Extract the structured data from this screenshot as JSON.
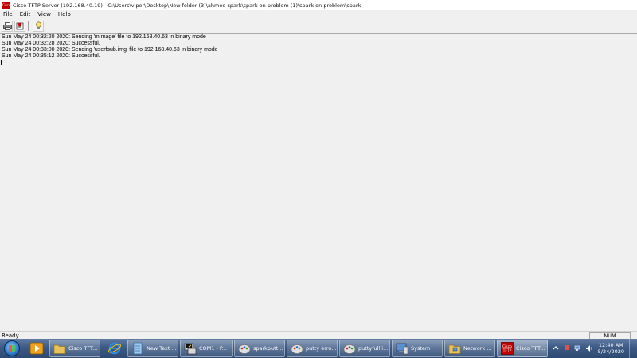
{
  "window": {
    "title": "Cisco TFTP Server (192.168.40.19) - C:\\Users\\viper\\Desktop\\New folder (3)\\ahmed spark\\spark on problem (1)\\spark on problem\\spark",
    "icon_text": "Cisco"
  },
  "menu": [
    "File",
    "Edit",
    "View",
    "Help"
  ],
  "toolbar": {
    "icons": [
      "printer-icon",
      "log-icon",
      "help-icon"
    ]
  },
  "log": [
    "Sun May 24 00:32:20 2020: Sending 'mImage' file to 192.168.40.63 in binary mode",
    "Sun May 24 00:32:28 2020: Successful.",
    "Sun May 24 00:33:00 2020: Sending 'userfsub.img' file to 192.168.40.63 in binary mode",
    "Sun May 24 00:35:12 2020: Successful."
  ],
  "status": {
    "text": "Ready",
    "indicator": "NUM"
  },
  "taskbar": {
    "pinned": [
      {
        "name": "media-player-icon",
        "color": "#f0a020"
      },
      {
        "name": "internet-explorer-icon",
        "color": "#2a8ce0"
      }
    ],
    "buttons": [
      {
        "label": "Cisco TFT...",
        "icon": "folder-icon",
        "color": "#e8c25a",
        "active": false
      },
      {
        "label": "New Text ...",
        "icon": "notepad-icon",
        "color": "#9cc8f0",
        "active": false
      },
      {
        "label": "COM1 - P...",
        "icon": "putty-icon",
        "color": "#d8d8d8",
        "active": false
      },
      {
        "label": "sparkputt...",
        "icon": "paint-icon",
        "color": "#e0e0e0",
        "active": false
      },
      {
        "label": "putty erro...",
        "icon": "paint-icon",
        "color": "#e0e0e0",
        "active": false
      },
      {
        "label": "puttyfull i...",
        "icon": "paint-icon",
        "color": "#e0e0e0",
        "active": false
      },
      {
        "label": "System",
        "icon": "system-icon",
        "color": "#5a8fd0",
        "active": false
      },
      {
        "label": "Network ...",
        "icon": "network-icon",
        "color": "#e8c25a",
        "active": false
      },
      {
        "label": "Cisco TFT...",
        "icon": "cisco-tftp-icon",
        "color": "#c00000",
        "active": true
      }
    ],
    "clock": {
      "time": "12:40 AM",
      "date": "5/24/2020"
    }
  }
}
